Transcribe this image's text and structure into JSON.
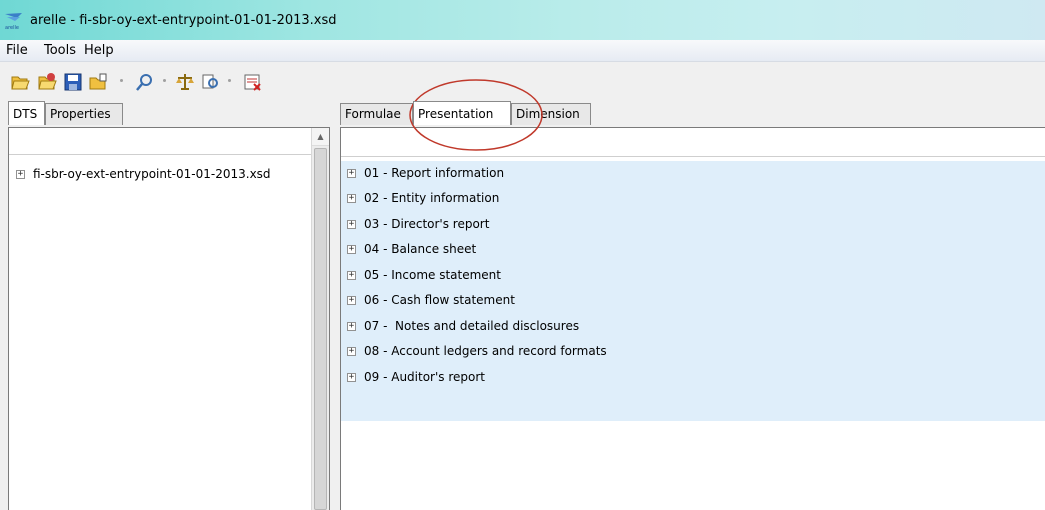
{
  "window": {
    "title": "arelle - fi-sbr-oy-ext-entrypoint-01-01-2013.xsd",
    "app_icon_label": "arelle"
  },
  "menubar": {
    "items": [
      "File",
      "Tools",
      "Help"
    ]
  },
  "toolbar": {
    "icons": [
      "open-folder-icon",
      "open-web-icon",
      "save-icon",
      "close-document-icon",
      "find-icon",
      "validate-icon",
      "compare-icon",
      "clear-log-icon"
    ]
  },
  "left_panel": {
    "tabs": [
      "DTS",
      "Properties"
    ],
    "active_tab": "DTS",
    "tree": [
      "fi-sbr-oy-ext-entrypoint-01-01-2013.xsd"
    ]
  },
  "right_panel": {
    "tabs": [
      "Formulae",
      "Presentation",
      "Dimension"
    ],
    "active_tab": "Presentation",
    "items": [
      "01 - Report information",
      "02 - Entity information",
      "03 - Director's report",
      "04 - Balance sheet",
      "05 - Income statement",
      "06 - Cash flow statement",
      "07 -  Notes and detailed disclosures",
      "08 - Account ledgers and record formats",
      "09 - Auditor's report"
    ]
  },
  "colors": {
    "titlebar": "#6fd8d4",
    "list_highlight": "#dfeefa",
    "annotation": "#c0392b"
  },
  "expander_symbol": "+"
}
